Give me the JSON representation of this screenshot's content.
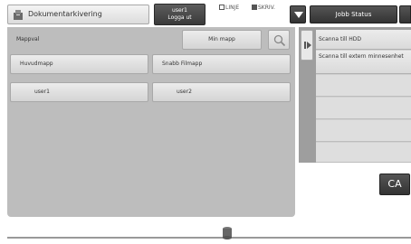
{
  "header": {
    "title": "Dokumentarkivering",
    "user_line1": "user1",
    "user_line2": "Logga ut",
    "status_linje": "LINJE",
    "status_skriv": "SKRIV.",
    "job_status": "Jobb Status"
  },
  "main": {
    "section_label": "Mappval",
    "my_folder": "Min mapp",
    "folders": [
      "Huvudmapp",
      "Snabb Filmapp"
    ],
    "users": [
      "user1",
      "user2"
    ]
  },
  "right": {
    "items": [
      "Scanna till HDD",
      "Scanna till extern minnesenhet"
    ]
  },
  "ca_label": "CA",
  "icons": {
    "home": "document-filing-icon",
    "search": "search-icon",
    "dropdown": "chevron-down-icon",
    "collapse": "panel-toggle-icon",
    "storage": "storage-icon"
  }
}
